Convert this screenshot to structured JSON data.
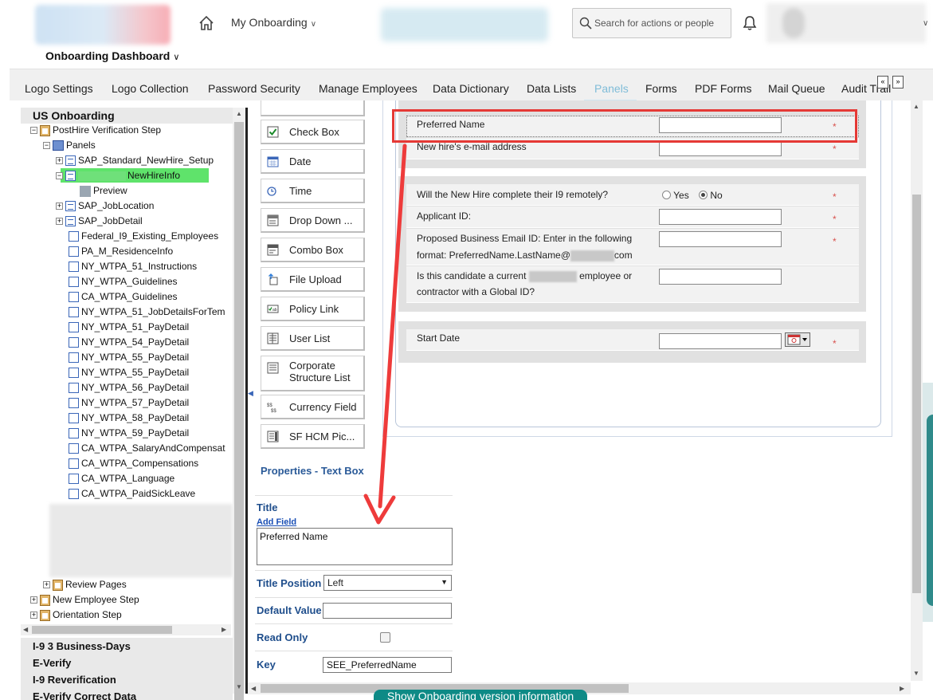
{
  "header": {
    "app_menu": "My Onboarding",
    "search_placeholder": "Search for actions or people",
    "dashboard_title": "Onboarding Dashboard"
  },
  "tabs": [
    {
      "label": "Logo Settings",
      "active": false
    },
    {
      "label": "Logo Collection",
      "active": false
    },
    {
      "label": "Password Security",
      "active": false
    },
    {
      "label": "Manage Employees",
      "active": false
    },
    {
      "label": "Data Dictionary",
      "active": false
    },
    {
      "label": "Data Lists",
      "active": false
    },
    {
      "label": "Panels",
      "active": true
    },
    {
      "label": "Forms",
      "active": false
    },
    {
      "label": "PDF Forms",
      "active": false
    },
    {
      "label": "Mail Queue",
      "active": false
    },
    {
      "label": "Audit Trail",
      "active": false
    }
  ],
  "tab_nav": {
    "prev": "«",
    "next": "»"
  },
  "tree": {
    "root": "US Onboarding",
    "step": "PostHire Verification Step",
    "panels": "Panels",
    "items": [
      "SAP_Standard_NewHire_Setup",
      "NewHireInfo",
      "Preview",
      "SAP_JobLocation",
      "SAP_JobDetail",
      "Federal_I9_Existing_Employees",
      "PA_M_ResidenceInfo",
      "NY_WTPA_51_Instructions",
      "NY_WTPA_Guidelines",
      "CA_WTPA_Guidelines",
      "NY_WTPA_51_JobDetailsForTem",
      "NY_WTPA_51_PayDetail",
      "NY_WTPA_54_PayDetail",
      "NY_WTPA_55_PayDetail",
      "NY_WTPA_55_PayDetail",
      "NY_WTPA_56_PayDetail",
      "NY_WTPA_57_PayDetail",
      "NY_WTPA_58_PayDetail",
      "NY_WTPA_59_PayDetail",
      "CA_WTPA_SalaryAndCompensat",
      "CA_WTPA_Compensations",
      "CA_WTPA_Language",
      "CA_WTPA_PaidSickLeave"
    ],
    "review_pages": "Review Pages",
    "new_employee_step": "New Employee Step",
    "orientation_step": "Orientation Step"
  },
  "sections": [
    "I-9 3 Business-Days",
    "E-Verify",
    "I-9 Reverification",
    "E-Verify Correct Data"
  ],
  "palette": [
    {
      "label": "Check Box",
      "icon": "checkbox-icon"
    },
    {
      "label": "Date",
      "icon": "calendar-icon"
    },
    {
      "label": "Time",
      "icon": "clock-icon"
    },
    {
      "label": "Drop Down ...",
      "icon": "dropdown-icon"
    },
    {
      "label": "Combo Box",
      "icon": "combobox-icon"
    },
    {
      "label": "File Upload",
      "icon": "upload-icon"
    },
    {
      "label": "Policy Link",
      "icon": "policy-link-icon"
    },
    {
      "label": "User List",
      "icon": "user-list-icon"
    },
    {
      "label": "Corporate Structure List",
      "icon": "corporate-structure-icon"
    },
    {
      "label": "Currency Field",
      "icon": "currency-icon"
    },
    {
      "label": "SF HCM Pic...",
      "icon": "sf-hcm-icon"
    }
  ],
  "properties": {
    "title": "Properties - Text Box",
    "title_label": "Title",
    "add_field": "Add Field",
    "title_value": "Preferred Name",
    "title_position_label": "Title Position",
    "title_position_value": "Left",
    "default_value_label": "Default Value",
    "default_value": "",
    "read_only_label": "Read Only",
    "key_label": "Key",
    "key_value": "SEE_PreferredName"
  },
  "form": {
    "preferred_name": "Preferred Name",
    "email": "New hire's e-mail address",
    "i9_question": "Will the New Hire complete their I9 remotely?",
    "yes": "Yes",
    "no": "No",
    "applicant_id": "Applicant ID:",
    "proposed_email_1": "Proposed Business Email ID: Enter in the following",
    "proposed_email_2a": "format: PreferredName.LastName@",
    "proposed_email_2b": "com",
    "candidate_1a": "Is this candidate a current",
    "candidate_1b": "employee or",
    "candidate_2": "contractor with a Global ID?",
    "start_date": "Start Date",
    "required_mark": "*"
  },
  "footer": {
    "version_button": "Show Onboarding version information"
  }
}
